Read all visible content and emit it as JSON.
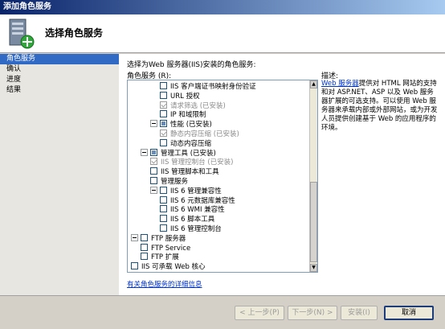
{
  "window": {
    "title": "添加角色服务"
  },
  "header": {
    "title": "选择角色服务",
    "icon": "server-add-icon"
  },
  "nav": {
    "items": [
      {
        "label": "角色服务",
        "active": true
      },
      {
        "label": "确认",
        "active": false
      },
      {
        "label": "进度",
        "active": false
      },
      {
        "label": "结果",
        "active": false
      }
    ]
  },
  "main": {
    "prompt": "选择为Web 服务器(IIS)安装的角色服务:",
    "list_label": "角色服务 (R):",
    "tree": [
      {
        "label": "IIS 客户端证书映射身份验证",
        "state": "unchecked",
        "indent": 3,
        "grey": false
      },
      {
        "label": "URL 授权",
        "state": "unchecked",
        "indent": 3,
        "grey": false
      },
      {
        "label": "请求筛选  (已安装)",
        "state": "checked-disabled",
        "indent": 3,
        "grey": true
      },
      {
        "label": "IP 和域限制",
        "state": "unchecked",
        "indent": 3,
        "grey": false
      },
      {
        "label": "性能  (已安装)",
        "state": "partial",
        "indent": 2,
        "grey": false,
        "expander": true
      },
      {
        "label": "静态内容压缩  (已安装)",
        "state": "checked-disabled",
        "indent": 3,
        "grey": true
      },
      {
        "label": "动态内容压缩",
        "state": "unchecked",
        "indent": 3,
        "grey": false
      },
      {
        "label": "管理工具  (已安装)",
        "state": "partial",
        "indent": 1,
        "grey": false,
        "expander": true
      },
      {
        "label": "IIS 管理控制台  (已安装)",
        "state": "checked-disabled",
        "indent": 2,
        "grey": true
      },
      {
        "label": "IIS 管理脚本和工具",
        "state": "unchecked",
        "indent": 2,
        "grey": false
      },
      {
        "label": "管理服务",
        "state": "unchecked",
        "indent": 2,
        "grey": false
      },
      {
        "label": "IIS 6 管理兼容性",
        "state": "unchecked",
        "indent": 2,
        "grey": false,
        "expander": true
      },
      {
        "label": "IIS 6 元数据库兼容性",
        "state": "unchecked",
        "indent": 3,
        "grey": false
      },
      {
        "label": "IIS 6 WMI 兼容性",
        "state": "unchecked",
        "indent": 3,
        "grey": false
      },
      {
        "label": "IIS 6 脚本工具",
        "state": "unchecked",
        "indent": 3,
        "grey": false
      },
      {
        "label": "IIS 6 管理控制台",
        "state": "unchecked",
        "indent": 3,
        "grey": false
      },
      {
        "label": "FTP 服务器",
        "state": "unchecked",
        "indent": 0,
        "grey": false,
        "expander": true
      },
      {
        "label": "FTP Service",
        "state": "unchecked",
        "indent": 1,
        "grey": false
      },
      {
        "label": "FTP 扩展",
        "state": "unchecked",
        "indent": 1,
        "grey": false
      },
      {
        "label": "IIS 可承载 Web 核心",
        "state": "unchecked",
        "indent": 0,
        "grey": false
      }
    ],
    "description_title": "描述:",
    "description_link": "Web 服务器",
    "description_text": "提供对 HTML 网站的支持和对 ASP.NET、ASP 以及 Web 服务器扩展的可选支持。可以使用 Web 服务器来承载内部或外部网站，或为开发人员提供创建基于 Web 的应用程序的环境。",
    "more_info_link": "有关角色服务的详细信息"
  },
  "footer": {
    "back_label": "< 上一步(P)",
    "next_label": "下一步(N) >",
    "install_label": "安装(I)",
    "cancel_label": "取消"
  }
}
